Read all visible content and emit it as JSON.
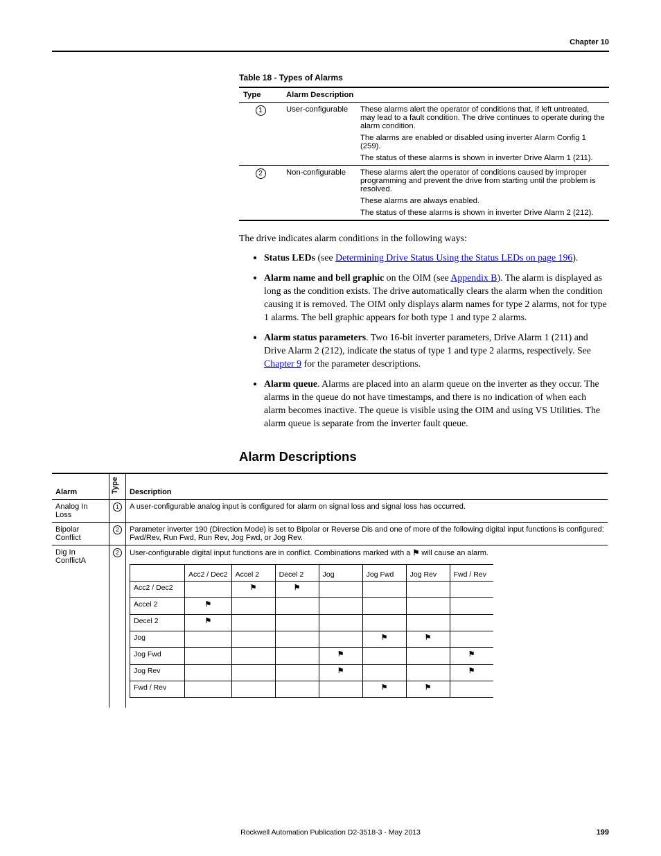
{
  "header": {
    "chapter": "Chapter 10"
  },
  "table18": {
    "caption": "Table 18 - Types of Alarms",
    "headers": {
      "type": "Type",
      "desc": "Alarm Description"
    },
    "rows": [
      {
        "type": "1",
        "name": "User-configurable",
        "p1": "These alarms alert the operator of conditions that, if left untreated, may lead to a fault condition. The drive continues to operate during the alarm condition.",
        "p2": "The alarms are enabled or disabled using inverter Alarm Config 1 (259).",
        "p3": "The status of these alarms is shown in inverter Drive Alarm 1 (211)."
      },
      {
        "type": "2",
        "name": "Non-configurable",
        "p1": "These alarms alert the operator of conditions caused by improper programming and prevent the drive from starting until the problem is resolved.",
        "p2": "These alarms are always enabled.",
        "p3": "The status of these alarms is shown in inverter Drive Alarm 2 (212)."
      }
    ]
  },
  "body": {
    "intro": "The drive indicates alarm conditions in the following ways:",
    "b1_strong": "Status LEDs",
    "b1_mid": " (see ",
    "b1_link": "Determining Drive Status Using the Status LEDs on page 196",
    "b1_end": ").",
    "b2_strong": "Alarm name and bell graphic",
    "b2_mid": " on the OIM (see ",
    "b2_link": "Appendix B",
    "b2_end": "). The alarm is displayed as long as the condition exists. The drive automatically clears the alarm when the condition causing it is removed. The OIM only displays alarm names for type 2 alarms, not for type 1 alarms. The bell graphic appears for both type 1 and type 2 alarms.",
    "b3_strong": "Alarm status parameters",
    "b3_mid1": ". Two 16-bit inverter parameters, Drive Alarm 1 (211) and Drive Alarm 2 (212), indicate the status of type 1 and type 2 alarms, respectively. See ",
    "b3_link": "Chapter 9",
    "b3_end": " for the parameter descriptions.",
    "b4_strong": "Alarm queue",
    "b4_text": ". Alarms are placed into an alarm queue on the inverter as they occur. The alarms in the queue do not have timestamps, and there is no indication of when each alarm becomes inactive. The queue is visible using the OIM and using VS Utilities. The alarm queue is separate from the inverter fault queue."
  },
  "section2": {
    "heading": "Alarm Descriptions",
    "headers": {
      "alarm": "Alarm",
      "type": "Type",
      "desc": "Description"
    },
    "r1": {
      "alarm": "Analog In Loss",
      "type": "1",
      "desc": "A user-configurable analog input is configured for alarm on signal loss and signal loss has occurred."
    },
    "r2": {
      "alarm": "Bipolar Conflict",
      "type": "2",
      "desc": "Parameter inverter 190 (Direction Mode) is set to Bipolar or Reverse Dis and one of more of the following digital input functions is configured: Fwd/Rev, Run Fwd, Run Rev, Jog Fwd, or Jog Rev."
    },
    "r3": {
      "alarm": "Dig In ConflictA",
      "type": "2",
      "desc_pre": "User-configurable digital input functions are in conflict. Combinations marked with a ",
      "desc_post": " will cause an alarm.",
      "matrix": {
        "cols": [
          "",
          "Acc2 / Dec2",
          "Accel 2",
          "Decel 2",
          "Jog",
          "Jog Fwd",
          "Jog Rev",
          "Fwd / Rev"
        ],
        "rows": [
          {
            "label": "Acc2 / Dec2",
            "marks": [
              0,
              1,
              1,
              0,
              0,
              0,
              0
            ]
          },
          {
            "label": "Accel 2",
            "marks": [
              1,
              0,
              0,
              0,
              0,
              0,
              0
            ]
          },
          {
            "label": "Decel 2",
            "marks": [
              1,
              0,
              0,
              0,
              0,
              0,
              0
            ]
          },
          {
            "label": "Jog",
            "marks": [
              0,
              0,
              0,
              0,
              1,
              1,
              0
            ]
          },
          {
            "label": "Jog Fwd",
            "marks": [
              0,
              0,
              0,
              1,
              0,
              0,
              1
            ]
          },
          {
            "label": "Jog Rev",
            "marks": [
              0,
              0,
              0,
              1,
              0,
              0,
              1
            ]
          },
          {
            "label": "Fwd / Rev",
            "marks": [
              0,
              0,
              0,
              0,
              1,
              1,
              0
            ]
          }
        ]
      }
    }
  },
  "footer": {
    "pub": "Rockwell Automation Publication D2-3518-3 - May 2013",
    "page": "199"
  }
}
